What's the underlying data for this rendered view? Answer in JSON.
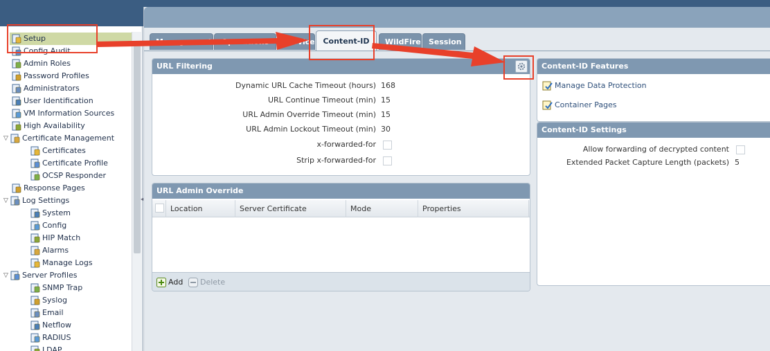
{
  "nav": {
    "items": [
      {
        "label": "Setup",
        "icon": "setup-icon",
        "indent": 0,
        "selected": true
      },
      {
        "label": "Config Audit",
        "icon": "config-audit-icon",
        "indent": 0
      },
      {
        "label": "Admin Roles",
        "icon": "admin-roles-icon",
        "indent": 0
      },
      {
        "label": "Password Profiles",
        "icon": "password-profiles-icon",
        "indent": 0
      },
      {
        "label": "Administrators",
        "icon": "administrators-icon",
        "indent": 0
      },
      {
        "label": "User Identification",
        "icon": "user-identification-icon",
        "indent": 0
      },
      {
        "label": "VM Information Sources",
        "icon": "vm-information-icon",
        "indent": 0
      },
      {
        "label": "High Availability",
        "icon": "high-availability-icon",
        "indent": 0
      },
      {
        "label": "Certificate Management",
        "icon": "certificate-management-icon",
        "indent": 0,
        "expandable": true
      },
      {
        "label": "Certificates",
        "icon": "certificates-icon",
        "indent": 1
      },
      {
        "label": "Certificate Profile",
        "icon": "certificate-profile-icon",
        "indent": 1
      },
      {
        "label": "OCSP Responder",
        "icon": "ocsp-responder-icon",
        "indent": 1
      },
      {
        "label": "Response Pages",
        "icon": "response-pages-icon",
        "indent": 0
      },
      {
        "label": "Log Settings",
        "icon": "log-settings-icon",
        "indent": 0,
        "expandable": true
      },
      {
        "label": "System",
        "icon": "system-icon",
        "indent": 1
      },
      {
        "label": "Config",
        "icon": "config-icon",
        "indent": 1
      },
      {
        "label": "HIP Match",
        "icon": "hip-match-icon",
        "indent": 1
      },
      {
        "label": "Alarms",
        "icon": "alarms-icon",
        "indent": 1
      },
      {
        "label": "Manage Logs",
        "icon": "manage-logs-icon",
        "indent": 1
      },
      {
        "label": "Server Profiles",
        "icon": "server-profiles-icon",
        "indent": 0,
        "expandable": true
      },
      {
        "label": "SNMP Trap",
        "icon": "snmp-trap-icon",
        "indent": 1
      },
      {
        "label": "Syslog",
        "icon": "syslog-icon",
        "indent": 1
      },
      {
        "label": "Email",
        "icon": "email-icon",
        "indent": 1
      },
      {
        "label": "Netflow",
        "icon": "netflow-icon",
        "indent": 1
      },
      {
        "label": "RADIUS",
        "icon": "radius-icon",
        "indent": 1
      },
      {
        "label": "LDAP",
        "icon": "ldap-icon",
        "indent": 1
      }
    ]
  },
  "tabs": [
    {
      "label": "Management",
      "active": false
    },
    {
      "label": "Operations",
      "active": false
    },
    {
      "label": "Services",
      "active": false
    },
    {
      "label": "Content-ID",
      "active": true
    },
    {
      "label": "WildFire",
      "active": false
    },
    {
      "label": "Session",
      "active": false
    }
  ],
  "url_filtering": {
    "title": "URL Filtering",
    "rows": [
      {
        "label": "Dynamic URL Cache Timeout (hours)",
        "value": "168"
      },
      {
        "label": "URL Continue Timeout (min)",
        "value": "15"
      },
      {
        "label": "URL Admin Override Timeout (min)",
        "value": "15"
      },
      {
        "label": "URL Admin Lockout Timeout (min)",
        "value": "30"
      },
      {
        "label": "x-forwarded-for",
        "checkbox": true
      },
      {
        "label": "Strip x-forwarded-for",
        "checkbox": true
      }
    ]
  },
  "url_admin_override": {
    "title": "URL Admin Override",
    "columns": [
      "Location",
      "Server Certificate",
      "Mode",
      "Properties"
    ],
    "add_label": "Add",
    "delete_label": "Delete"
  },
  "features": {
    "title": "Content-ID Features",
    "links": [
      {
        "label": "Manage Data Protection"
      },
      {
        "label": "Container Pages"
      }
    ]
  },
  "settings": {
    "title": "Content-ID Settings",
    "rows": [
      {
        "label": "Allow forwarding of decrypted content",
        "checkbox": true
      },
      {
        "label": "Extended Packet Capture Length (packets)",
        "value": "5"
      }
    ]
  },
  "colors": {
    "annotation": "#e8402a",
    "panel_header": "#7f98b1",
    "selected_nav": "#cfd9a5"
  }
}
